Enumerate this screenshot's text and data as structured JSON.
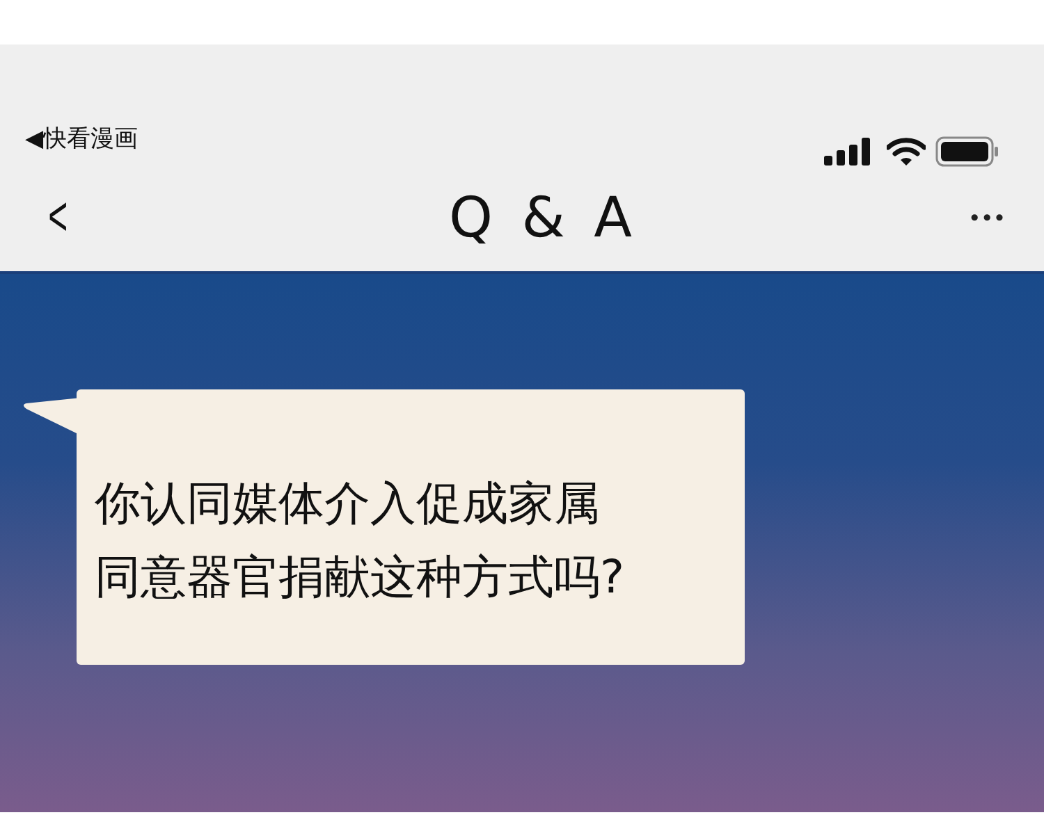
{
  "status_bar": {
    "back_app": "◀快看漫画"
  },
  "nav_bar": {
    "back": "<",
    "title": "Q & A",
    "more": "•••"
  },
  "speech_bubble": {
    "lines": [
      "你认同媒体介入促成家属",
      "同意器官捐献这种方式吗?"
    ]
  }
}
